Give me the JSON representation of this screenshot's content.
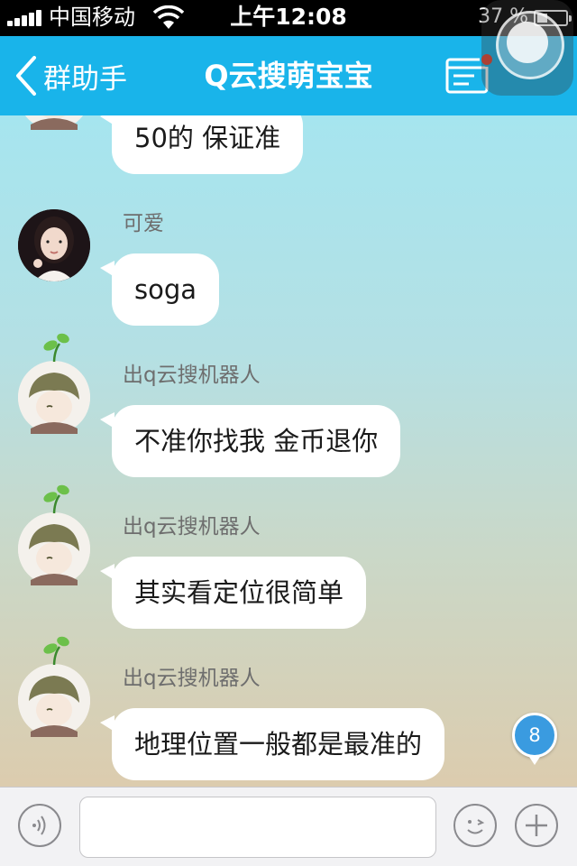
{
  "status_bar": {
    "carrier": "中国移动",
    "time": "上午12:08",
    "battery": "37 %",
    "battery_level": 0.37
  },
  "nav": {
    "back_label": "群助手",
    "title": "Q云搜萌宝宝"
  },
  "messages": [
    {
      "sender": "",
      "text": "50的 保证准",
      "avatar": "bot-avatar"
    },
    {
      "sender": "可爱",
      "text": "soga",
      "avatar": "girl-avatar"
    },
    {
      "sender": "出q云搜机器人",
      "text": "不准你找我 金币退你",
      "avatar": "bot-avatar"
    },
    {
      "sender": "出q云搜机器人",
      "text": "其实看定位很简单",
      "avatar": "bot-avatar"
    },
    {
      "sender": "出q云搜机器人",
      "text": "地理位置一般都是最准的",
      "avatar": "bot-avatar"
    }
  ],
  "unread_count": "8",
  "input": {
    "value": "",
    "placeholder": ""
  },
  "colors": {
    "nav": "#19b4ea",
    "badge": "#3a9be0",
    "notification_dot": "#e8422e"
  },
  "icons": [
    "signal-icon",
    "wifi-icon",
    "battery-icon",
    "back-chevron-icon",
    "group-info-icon",
    "assistive-touch-icon",
    "voice-icon",
    "emoji-icon",
    "plus-icon"
  ]
}
